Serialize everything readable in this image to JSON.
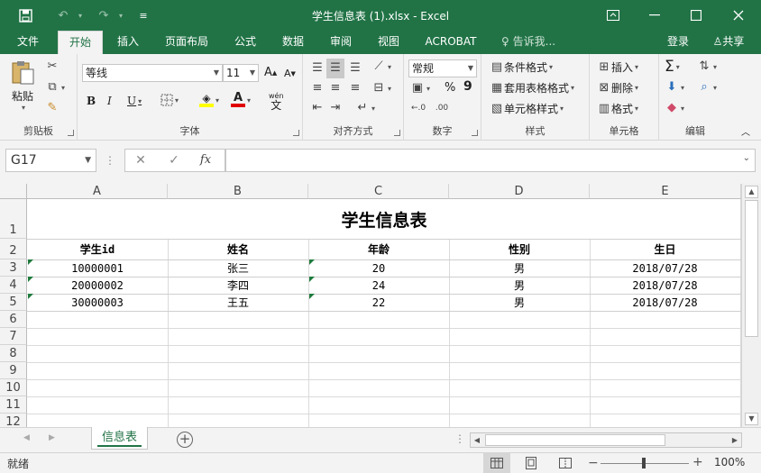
{
  "titlebar": {
    "title": "学生信息表 (1).xlsx - Excel",
    "save_icon": "save-icon",
    "undo_icon": "undo-icon",
    "redo_icon": "redo-icon",
    "customize_icon": "customize-qat-icon"
  },
  "tabs": [
    {
      "label": "文件",
      "active": false
    },
    {
      "label": "开始",
      "active": true
    },
    {
      "label": "插入",
      "active": false
    },
    {
      "label": "页面布局",
      "active": false
    },
    {
      "label": "公式",
      "active": false
    },
    {
      "label": "数据",
      "active": false
    },
    {
      "label": "审阅",
      "active": false
    },
    {
      "label": "视图",
      "active": false
    },
    {
      "label": "ACROBAT",
      "active": false
    }
  ],
  "tell_me": "告诉我...",
  "login": "登录",
  "share": "共享",
  "ribbon": {
    "clipboard": {
      "label": "剪贴板",
      "paste": "粘贴"
    },
    "font": {
      "label": "字体",
      "font_name": "等线",
      "font_size": "11",
      "bold": "B",
      "italic": "I",
      "underline": "U",
      "grow": "A",
      "shrink": "A",
      "wen": "wén",
      "wen_char": "文",
      "font_color_letter": "A"
    },
    "alignment": {
      "label": "对齐方式"
    },
    "number": {
      "label": "数字",
      "format": "常规",
      "percent": "%",
      "comma": "9"
    },
    "styles": {
      "label": "样式",
      "conditional": "条件格式",
      "table": "套用表格格式",
      "cell": "单元格样式"
    },
    "cells": {
      "label": "单元格",
      "insert": "插入",
      "delete": "删除",
      "format": "格式"
    },
    "editing": {
      "label": "编辑",
      "sigma": "Σ"
    }
  },
  "formula_bar": {
    "name_box": "G17",
    "fx": "fx",
    "value": ""
  },
  "columns": [
    "A",
    "B",
    "C",
    "D",
    "E"
  ],
  "rows": [
    "1",
    "2",
    "3",
    "4",
    "5",
    "6",
    "7",
    "8",
    "9",
    "10",
    "11",
    "12"
  ],
  "sheet": {
    "title": "学生信息表",
    "headers": [
      "学生id",
      "姓名",
      "年龄",
      "性别",
      "生日"
    ],
    "data": [
      [
        "10000001",
        "张三",
        "20",
        "男",
        "2018/07/28"
      ],
      [
        "20000002",
        "李四",
        "24",
        "男",
        "2018/07/28"
      ],
      [
        "30000003",
        "王五",
        "22",
        "男",
        "2018/07/28"
      ]
    ]
  },
  "sheet_tab": "信息表",
  "status": {
    "ready": "就绪",
    "zoom": "100%"
  }
}
